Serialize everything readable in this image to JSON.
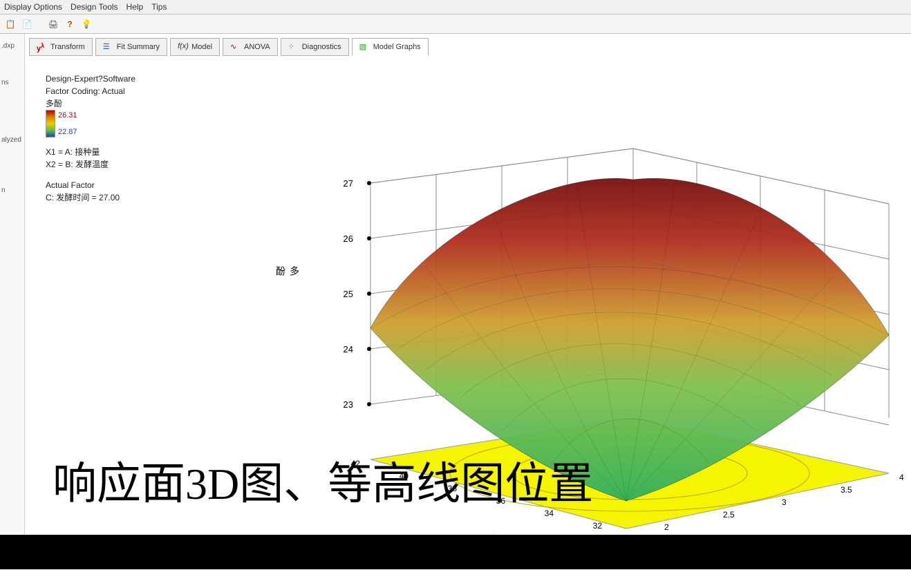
{
  "menu": {
    "display_options": "Display Options",
    "design_tools": "Design Tools",
    "help": "Help",
    "tips": "Tips"
  },
  "toolbar": {
    "icons": [
      "clipboard",
      "paste",
      "print",
      "help",
      "lightbulb"
    ]
  },
  "leftpane": {
    "file": ".dxp",
    "item1": "ns",
    "item2": "alyzed",
    "item3": "n"
  },
  "tabs": [
    {
      "label": "Transform",
      "icon": "y-lambda"
    },
    {
      "label": "Fit Summary",
      "icon": "bars"
    },
    {
      "label": "Model",
      "icon": "fx"
    },
    {
      "label": "ANOVA",
      "icon": "curve"
    },
    {
      "label": "Diagnostics",
      "icon": "scatter"
    },
    {
      "label": "Model Graphs",
      "icon": "surface",
      "active": true
    }
  ],
  "legend": {
    "software": "Design-Expert?Software",
    "coding": "Factor Coding: Actual",
    "response": "多酚",
    "max": "26.31",
    "min": "22.87",
    "x1": "X1 = A: 接种量",
    "x2": "X2 = B: 发酵温度",
    "actual_factor_title": "Actual Factor",
    "actual_factor": "C: 发酵时间 = 27.00"
  },
  "overlay": "响应面3D图、等高线图位置",
  "chart_data": {
    "type": "surface3d",
    "title": "",
    "zlabel": "多酚",
    "xlabel": "A: 接种量",
    "ylabel": "B: 发酵温度",
    "z_ticks": [
      23,
      24,
      25,
      26,
      27
    ],
    "x_ticks": [
      2.0,
      2.5,
      3.0,
      3.5,
      4.0
    ],
    "y_ticks": [
      32.0,
      34.0,
      36.0,
      38.0,
      40.0,
      42.0
    ],
    "x_range": [
      2.0,
      4.0
    ],
    "y_range": [
      32.0,
      42.0
    ],
    "z_range": [
      22.87,
      27
    ],
    "color_scale": {
      "low": 22.87,
      "high": 26.31
    },
    "peak_estimate": {
      "x": 3.0,
      "y": 37.0,
      "z": 26.3
    },
    "series_note": "Quadratic response surface with dome peak near center; corners drop to ~23-25; floor contour shown in yellow plane."
  }
}
